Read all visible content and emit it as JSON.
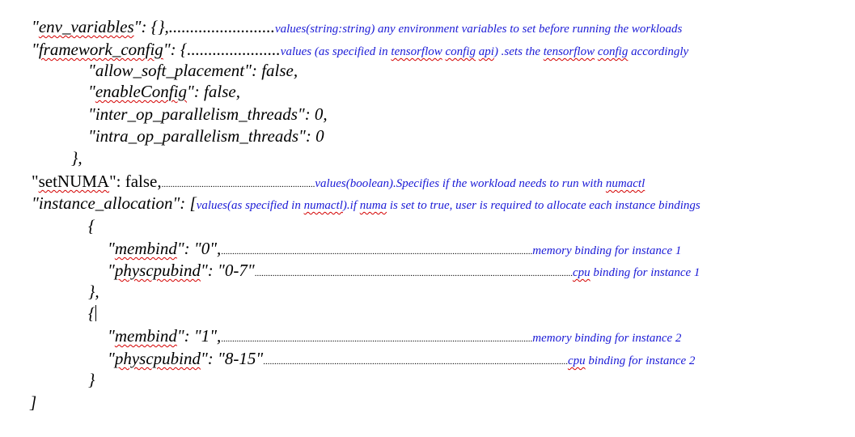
{
  "lines": {
    "env": {
      "open_quote": "\"",
      "key": "env_variables",
      "rest": "\": {},",
      "dots": ".........................",
      "note": "values(string:string) any environment variables to set before running the workloads"
    },
    "framework": {
      "open_quote": "\"",
      "key": "framework_config",
      "rest": "\": {",
      "dots": "......................",
      "note_a": "values (as specified in ",
      "note_tensorflow": "tensorflow",
      "note_sp1": " ",
      "note_config": "config",
      "note_sp2": " ",
      "note_api": "api",
      "note_b": ") .sets the ",
      "note_tensorflow2": "tensorflow",
      "note_sp3": " ",
      "note_config2": "config",
      "note_c": " accordingly"
    },
    "allow_soft": "\"allow_soft_placement\": false,",
    "enable_config": {
      "open_quote": "\"",
      "key": "enableConfig",
      "rest": "\": false,"
    },
    "inter_op": "\"inter_op_parallelism_threads\": 0,",
    "intra_op": "\"intra_op_parallelism_threads\": 0",
    "close_fw": "},",
    "set_numa": {
      "open_quote": "\"",
      "key": "setNUMA",
      "rest": "\": false,",
      "dots": ".....................................................................",
      "note_a": "values(boolean).Specifies if the workload needs to run with ",
      "note_numactl": "numactl"
    },
    "instance_alloc": {
      "key": "\"instance_allocation\": [",
      "note_a": "values(as specified in ",
      "note_numactl": "numactl",
      "note_b": ").if ",
      "note_numa": "numa",
      "note_c": " is set to true, user is required to allocate each instance bindings"
    },
    "open_1": "{",
    "membind_1": {
      "open_quote": "\"",
      "key": "membind",
      "rest": "\": \"0\",",
      "dots": "............................................................................................................................................",
      "note": "memory binding for instance 1"
    },
    "phys_1": {
      "open_quote": "\"",
      "key": "physcpubind",
      "rest": "\": \"0-7\"",
      "dots": "...............................................................................................................................................",
      "note_cpu": "cpu",
      "note_rest": " binding for instance 1"
    },
    "close_1": "},",
    "open_2": "{",
    "membind_2": {
      "open_quote": "\"",
      "key": "membind",
      "rest": "\": \"1\",",
      "dots": "............................................................................................................................................",
      "note": "memory binding for instance 2"
    },
    "phys_2": {
      "open_quote": "\"",
      "key": "physcpubind",
      "rest": "\": \"8-15\"",
      "dots": ".........................................................................................................................................",
      "note_cpu": "cpu",
      "note_rest": " binding for instance 2"
    },
    "close_2": "}",
    "close_arr": "]"
  },
  "colors": {
    "note_blue": "#1a1ad6",
    "spell_red": "#d40000",
    "text": "#000000"
  }
}
